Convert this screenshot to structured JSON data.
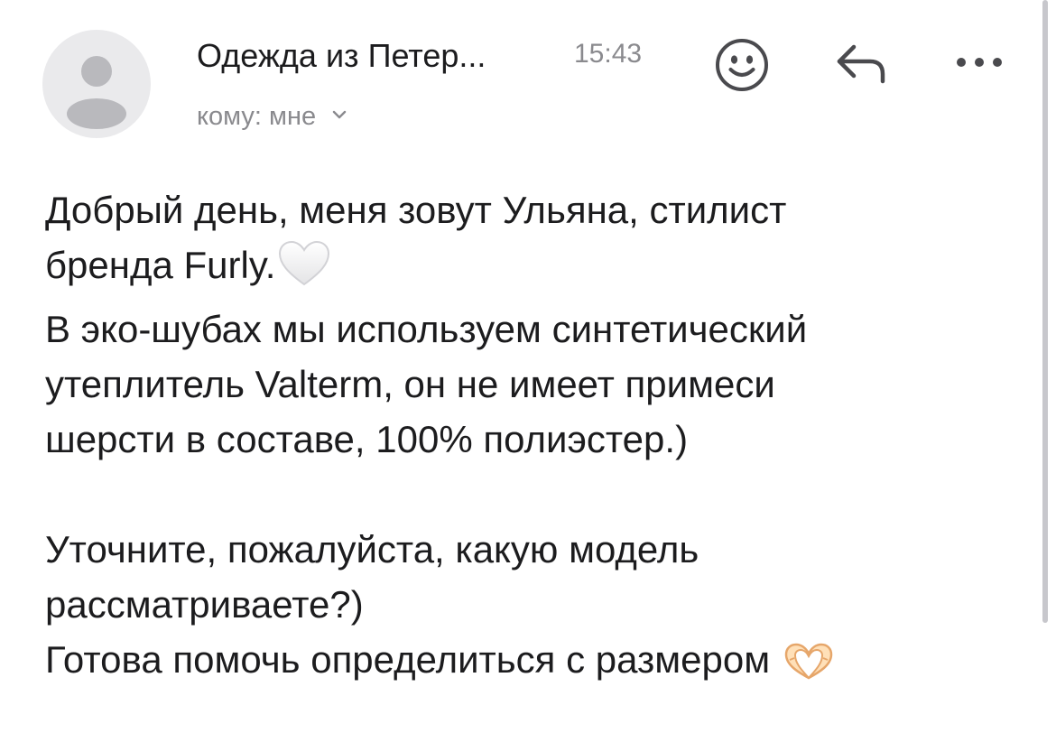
{
  "header": {
    "sender_name": "Одежда из Петер...",
    "time": "15:43",
    "recipient_label": "кому: мне",
    "icons": {
      "avatar": "person-placeholder-icon",
      "emoji": "smiley-face-icon",
      "reply": "reply-arrow-icon",
      "more": "more-dots-icon",
      "recipient_expand": "chevron-down-icon"
    }
  },
  "message": {
    "lines": [
      "Добрый день, меня зовут Ульяна, стилист",
      "бренда Furly.",
      "В эко-шубах мы используем синтетический",
      "утеплитель Valterm, он не имеет примеси",
      "шерсти в составе, 100% полиэстер.)",
      "",
      "Уточните, пожалуйста, какую модель",
      "рассматриваете?)",
      "Готова помочь определиться с размером"
    ],
    "emojis": {
      "after_line_2": "white-heart-emoji",
      "after_line_9": "heart-hands-emoji"
    }
  },
  "colors": {
    "text_primary": "#1c1c1e",
    "text_secondary": "#8a8a8e",
    "icon_gray": "#5b5b5f",
    "avatar_bg": "#eaeaec",
    "avatar_fg": "#b9b9bd"
  }
}
